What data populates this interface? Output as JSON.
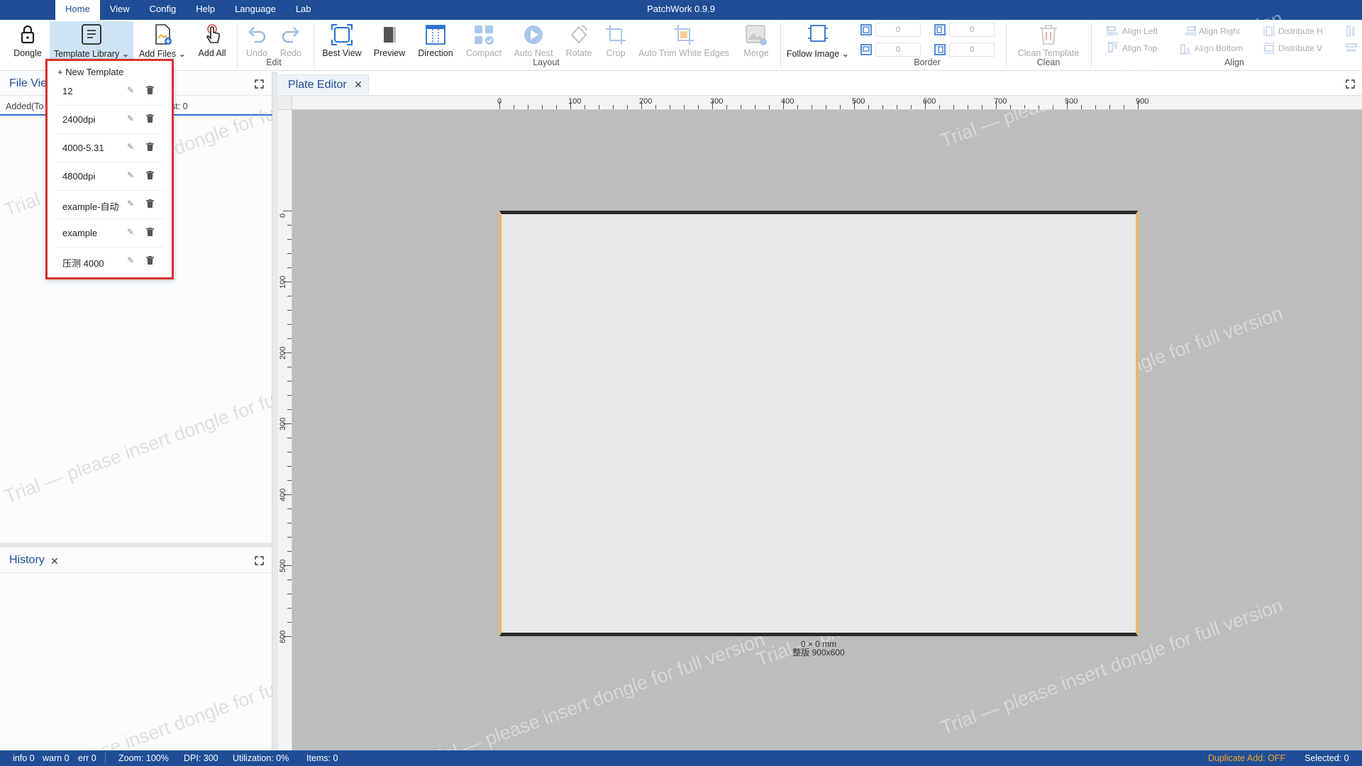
{
  "app": {
    "title": "PatchWork 0.9.9"
  },
  "menu": [
    "Home",
    "View",
    "Config",
    "Help",
    "Language",
    "Lab"
  ],
  "ribbon": {
    "dongle": "Dongle",
    "template_library": "Template Library",
    "add_files": "Add Files",
    "add_all": "Add All",
    "undo": "Undo",
    "redo": "Redo",
    "group_edit": "Edit",
    "best_view": "Best View",
    "preview": "Preview",
    "direction": "Direction",
    "compact": "Compact",
    "auto_nest": "Auto Nest",
    "rotate": "Rotate",
    "crop": "Crop",
    "auto_trim": "Auto Trim White Edges",
    "merge": "Merge",
    "group_layout": "Layout",
    "follow_image": "Follow Image",
    "border_values": [
      "0",
      "0",
      "0",
      "0"
    ],
    "group_border": "Border",
    "clean_template": "Clean Template",
    "group_clean": "Clean",
    "align_left": "Align Left",
    "align_right": "Align Right",
    "distribute_h": "Distribute H",
    "align_top": "Align Top",
    "align_bottom": "Align Bottom",
    "distribute_v": "Distribute V",
    "group_align": "Align"
  },
  "template_dropdown": {
    "new_label": "+ New Template",
    "items": [
      "12",
      "2400dpi",
      "4000-5.31",
      "4800dpi",
      "example-自动",
      "example",
      "压测 4000"
    ],
    "edit_glyph": "✎"
  },
  "file_view": {
    "tab": "File Vie",
    "sub_left": "Added(To",
    "sub_right": "st: 0"
  },
  "history": {
    "tab": "History"
  },
  "editor": {
    "tab": "Plate Editor",
    "ruler_h": [
      "0",
      "100",
      "200",
      "300",
      "400",
      "500",
      "600",
      "700",
      "800",
      "900"
    ],
    "ruler_v": [
      "0",
      "100",
      "200",
      "300",
      "400",
      "500",
      "600"
    ],
    "plate_size": "0 × 0 mm",
    "plate_label": "整版  900x600"
  },
  "watermark": "Trial — please insert dongle for full version",
  "status": {
    "info": "info 0",
    "warn": "warn 0",
    "err": "err 0",
    "zoom": "Zoom: 100%",
    "dpi": "DPI: 300",
    "utilization": "Utilization: 0%",
    "items": "Items: 0",
    "duplicate": "Duplicate Add: OFF",
    "selected": "Selected: 0"
  },
  "colors": {
    "brand": "#1f4e96",
    "accent_blue": "#2b6fd0",
    "highlight_red": "#d9322e",
    "plate_edge": "#f0b65a",
    "duplicate_orange": "#f5a623"
  },
  "close_glyph": "✕"
}
